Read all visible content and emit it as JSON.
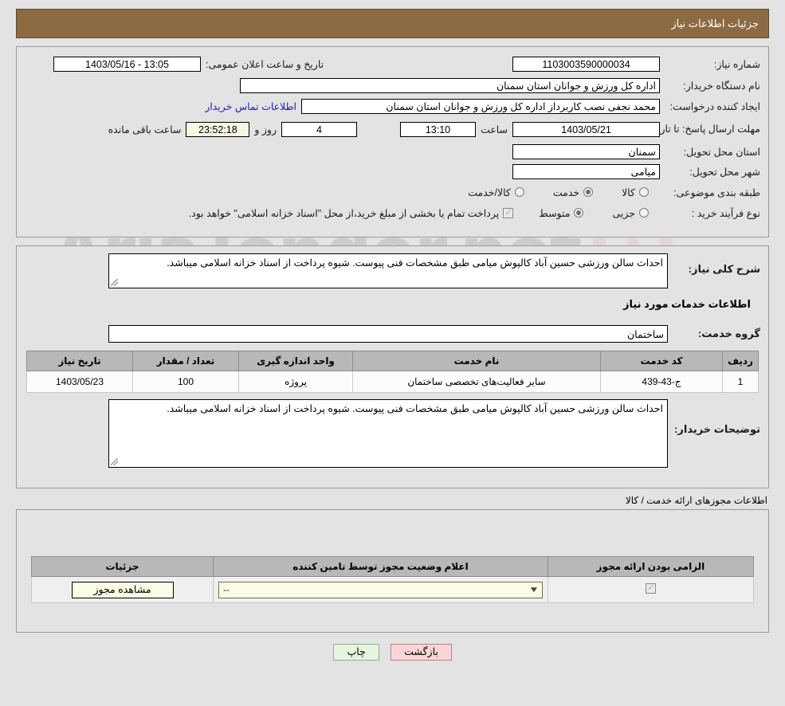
{
  "header": {
    "title": "جزئیات اطلاعات نیاز"
  },
  "watermark": {
    "text": "AriaTender.net"
  },
  "form": {
    "need_number_label": "شماره نیاز:",
    "need_number_value": "1103003590000034",
    "announce_label": "تاریخ و ساعت اعلان عمومی:",
    "announce_value": "1403/05/16 - 13:05",
    "buyer_org_label": "نام دستگاه خریدار:",
    "buyer_org_value": "اداره کل ورزش و جوانان استان سمنان",
    "creator_label": "ایجاد کننده درخواست:",
    "creator_value": "محمد نجفی نصب کاربرداز اداره کل ورزش و جوانان استان سمنان",
    "contact_link": "اطلاعات تماس خریدار",
    "deadline_label": "مهلت ارسال پاسخ: تا تاریخ:",
    "deadline_date": "1403/05/21",
    "deadline_hour_label": "ساعت",
    "deadline_hour": "13:10",
    "remaining_days": "4",
    "remaining_days_label": "روز و",
    "remaining_time": "23:52:18",
    "remaining_suffix": "ساعت باقی مانده",
    "province_label": "استان محل تحویل:",
    "province_value": "سمنان",
    "city_label": "شهر محل تحویل:",
    "city_value": "میامی",
    "category_label": "طبقه بندی موضوعی:",
    "category_options": [
      {
        "label": "کالا",
        "selected": false
      },
      {
        "label": "خدمت",
        "selected": true
      },
      {
        "label": "کالا/خدمت",
        "selected": false
      }
    ],
    "process_label": "نوع فرآیند خرید :",
    "process_options": [
      {
        "label": "جزیی",
        "selected": false
      },
      {
        "label": "متوسط",
        "selected": true
      }
    ],
    "treasury_checked": true,
    "treasury_note": "پرداخت تمام یا بخشی از مبلغ خرید،از محل \"اسناد خزانه اسلامی\" خواهد بود."
  },
  "need": {
    "summary_label": "شرح کلی نیاز:",
    "summary_value": "احداث سالن ورزشی حسین آباد کالپوش میامی  طبق مشخصات فنی پیوست. شیوه پرداخت از اسناد خزانه اسلامی میباشد.",
    "services_head": "اطلاعات خدمات مورد نیاز",
    "service_group_label": "گروه خدمت:",
    "service_group_value": "ساختمان",
    "buyer_notes_label": "توضیحات خریدار:",
    "buyer_notes_value": "احداث سالن ورزشی حسین آباد کالپوش میامی  طبق مشخصات فنی پیوست. شیوه پرداخت از اسناد خزانه اسلامی میباشد."
  },
  "services_table": {
    "columns": [
      "ردیف",
      "کد خدمت",
      "نام خدمت",
      "واحد اندازه گیری",
      "تعداد / مقدار",
      "تاریخ نیاز"
    ],
    "rows": [
      {
        "radif": "1",
        "code": "ج-43-439",
        "name": "سایر فعالیت‌های تخصصی ساختمان",
        "unit": "پروژه",
        "qty": "100",
        "date": "1403/05/23"
      }
    ]
  },
  "permits": {
    "section_title": "اطلاعات مجوزهای ارائه خدمت / کالا",
    "columns": [
      "الزامی بودن ارائه مجوز",
      "اعلام وضعیت مجوز توسط تامین کننده",
      "جزئیات"
    ],
    "rows": [
      {
        "required": true,
        "status_value": "--",
        "details_button": "مشاهده مجوز"
      }
    ]
  },
  "footer": {
    "back_label": "بازگشت",
    "print_label": "چاپ"
  }
}
